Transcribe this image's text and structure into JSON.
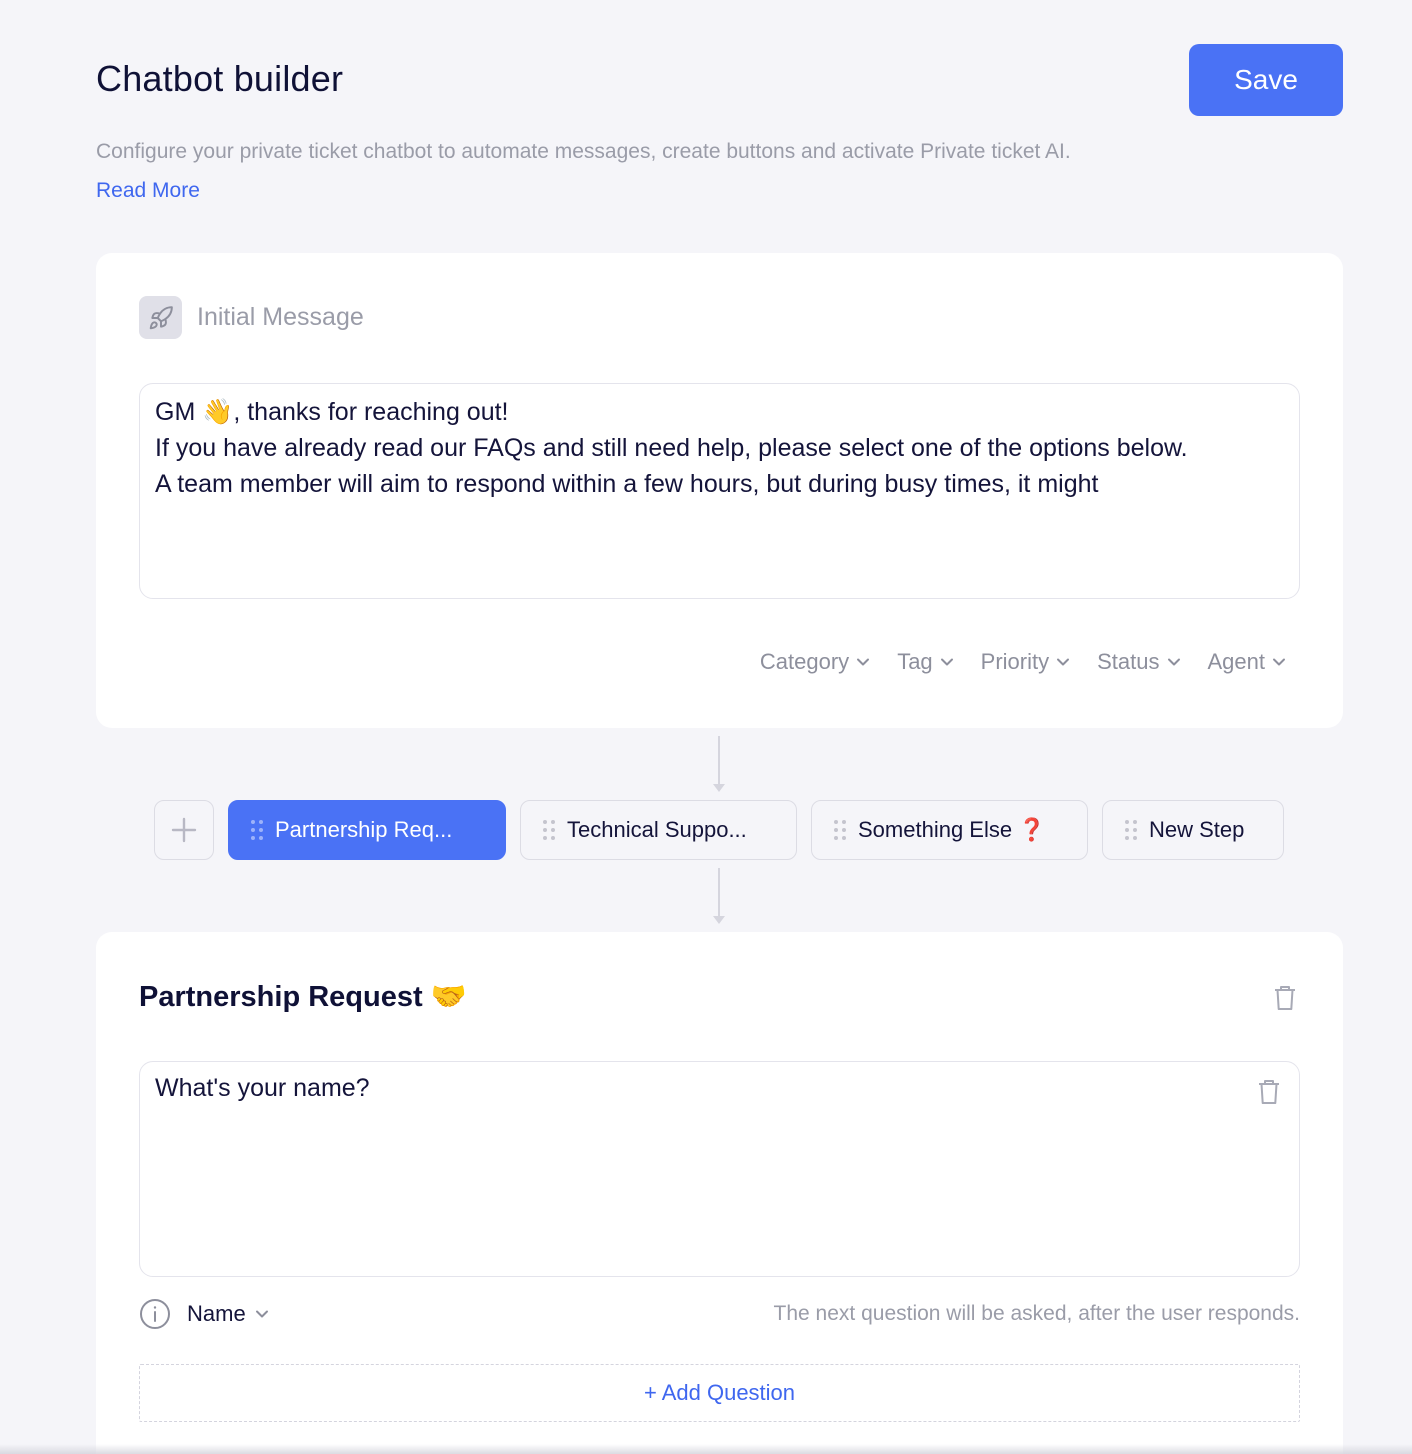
{
  "header": {
    "title": "Chatbot builder",
    "save_label": "Save",
    "subtitle": "Configure your private ticket chatbot to automate messages, create buttons and activate Private ticket AI.",
    "read_more": "Read More"
  },
  "initial_message": {
    "title": "Initial Message",
    "icon": "rocket-icon",
    "lines": [
      "GM 👋, thanks for reaching out!",
      "",
      "If you have already read our FAQs and still need help, please select one of the options below.",
      "",
      "A team member will aim to respond within a few hours, but during busy times, it might"
    ],
    "dropdowns": [
      "Category",
      "Tag",
      "Priority",
      "Status",
      "Agent"
    ]
  },
  "steps": {
    "add_icon": "plus-icon",
    "tabs": [
      {
        "label": "Partnership Req...",
        "active": true
      },
      {
        "label": "Technical Suppo...",
        "active": false
      },
      {
        "label": "Something Else ❓",
        "active": false
      },
      {
        "label": "New Step",
        "active": false
      }
    ]
  },
  "step_detail": {
    "title": "Partnership Request 🤝",
    "question": "What's your name?",
    "field_type": "Name",
    "hint": "The next question will be asked, after the user responds.",
    "add_question": "+ Add Question"
  },
  "colors": {
    "accent": "#4a72f5",
    "link": "#3f67ef",
    "background": "#f5f5f9"
  }
}
